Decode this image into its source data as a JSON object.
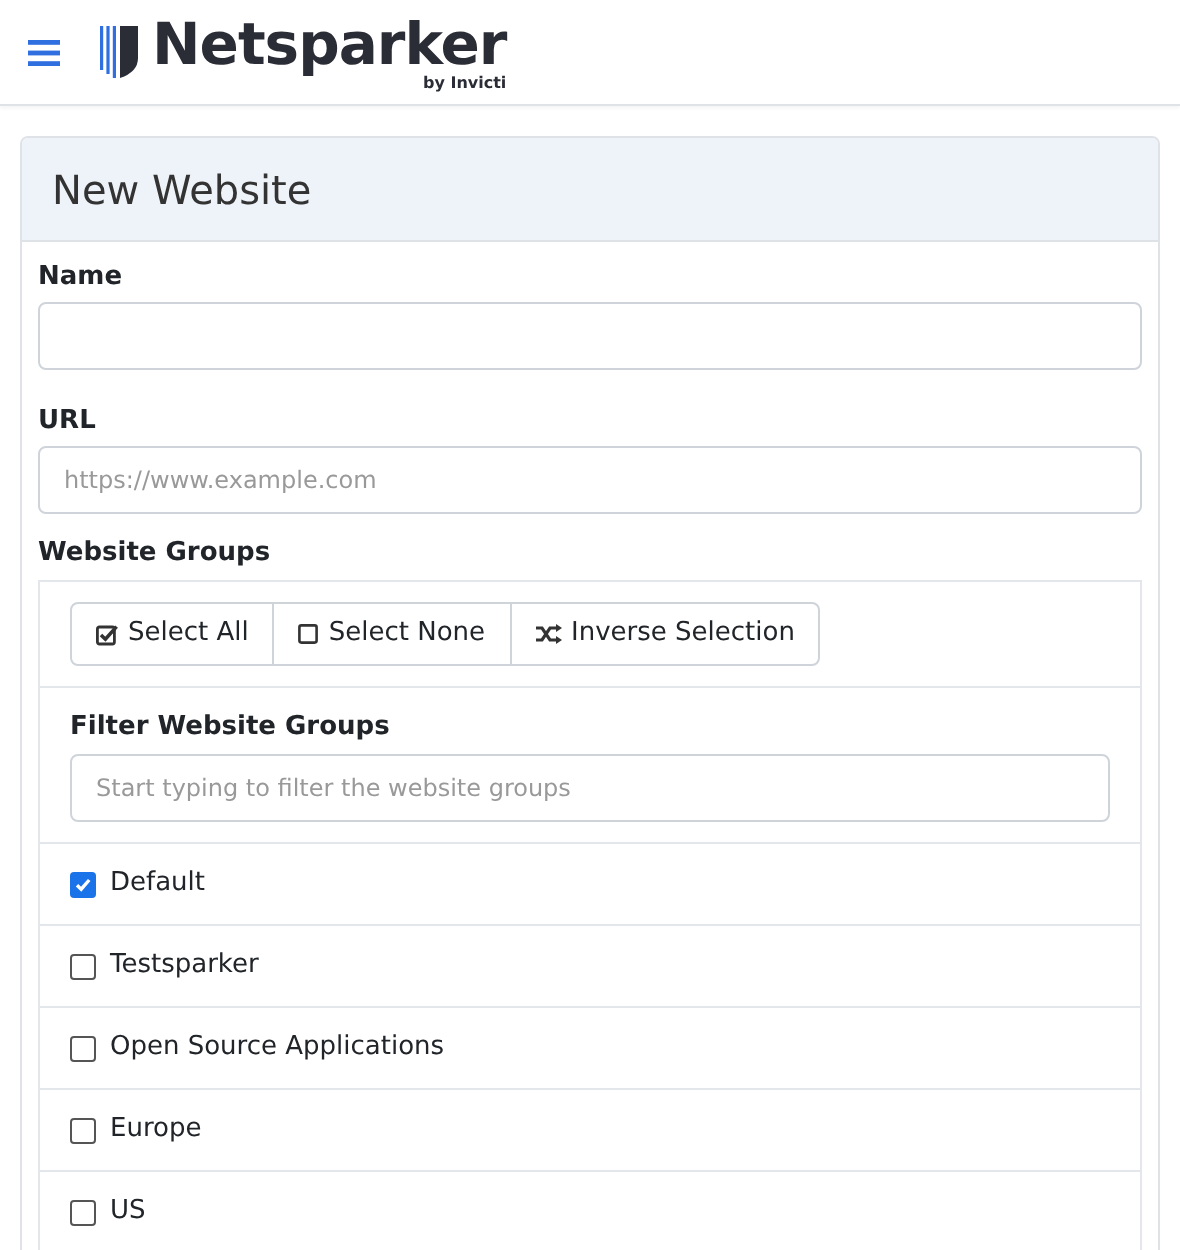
{
  "header": {
    "logo": {
      "name": "Netsparker",
      "tagline": "by Invicti"
    }
  },
  "card": {
    "title": "New Website",
    "fields": [
      {
        "label": "Name"
      },
      {
        "label": "URL",
        "placeholder": "https://www.example.com"
      }
    ],
    "groups": {
      "label": "Website Groups",
      "buttons": [
        {
          "label": "Select All"
        },
        {
          "label": "Select None"
        },
        {
          "label": "Inverse Selection"
        }
      ],
      "filter": {
        "label": "Filter Website Groups",
        "placeholder": "Start typing to filter the website groups"
      },
      "items": [
        {
          "label": "Default",
          "checked": true
        },
        {
          "label": "Testsparker",
          "checked": false
        },
        {
          "label": "Open Source Applications",
          "checked": false
        },
        {
          "label": "Europe",
          "checked": false
        },
        {
          "label": "US",
          "checked": false
        }
      ]
    }
  }
}
